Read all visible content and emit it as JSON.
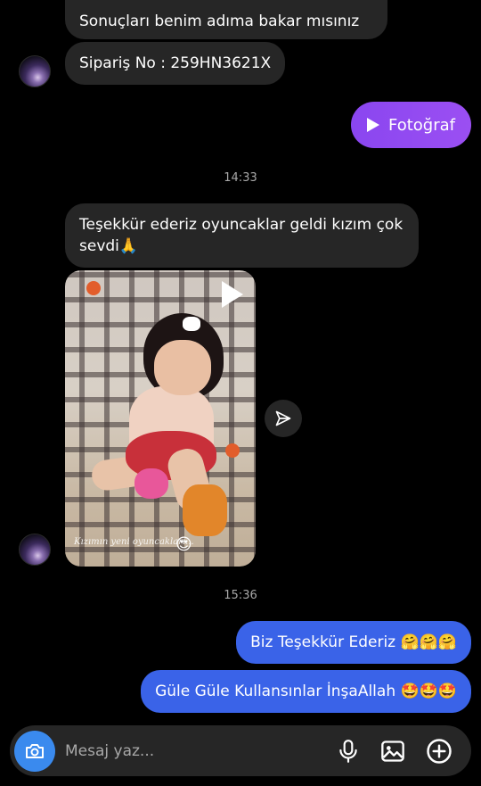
{
  "messages": {
    "cut_top_text": "Sonuçları benim adıma bakar mısınız",
    "order_text": "Sipariş No : 259HN3621X",
    "photo_label": "Fotoğraf",
    "time_1": "14:33",
    "thanks_text": "Teşekkür ederiz oyuncaklar geldi kızım çok sevdi🙏",
    "video_caption": "Kızımın yeni oyuncakları...",
    "video_emoji": "😍",
    "time_2": "15:36",
    "reply_1": "Biz Teşekkür Ederiz 🤗🤗🤗",
    "reply_2": "Güle Güle Kullansınlar İnşaAllah 🤩🤩🤩"
  },
  "composer": {
    "placeholder": "Mesaj yaz..."
  },
  "icons": {
    "camera": "camera-icon",
    "mic": "microphone-icon",
    "gallery": "gallery-icon",
    "add": "plus-icon",
    "share": "send-icon",
    "play": "play-icon"
  },
  "colors": {
    "background": "#000000",
    "incoming_bubble": "#262626",
    "outgoing_bubble": "#3a63e8",
    "photo_bubble": "#9b4ff2",
    "camera_button": "#3a8aee"
  }
}
